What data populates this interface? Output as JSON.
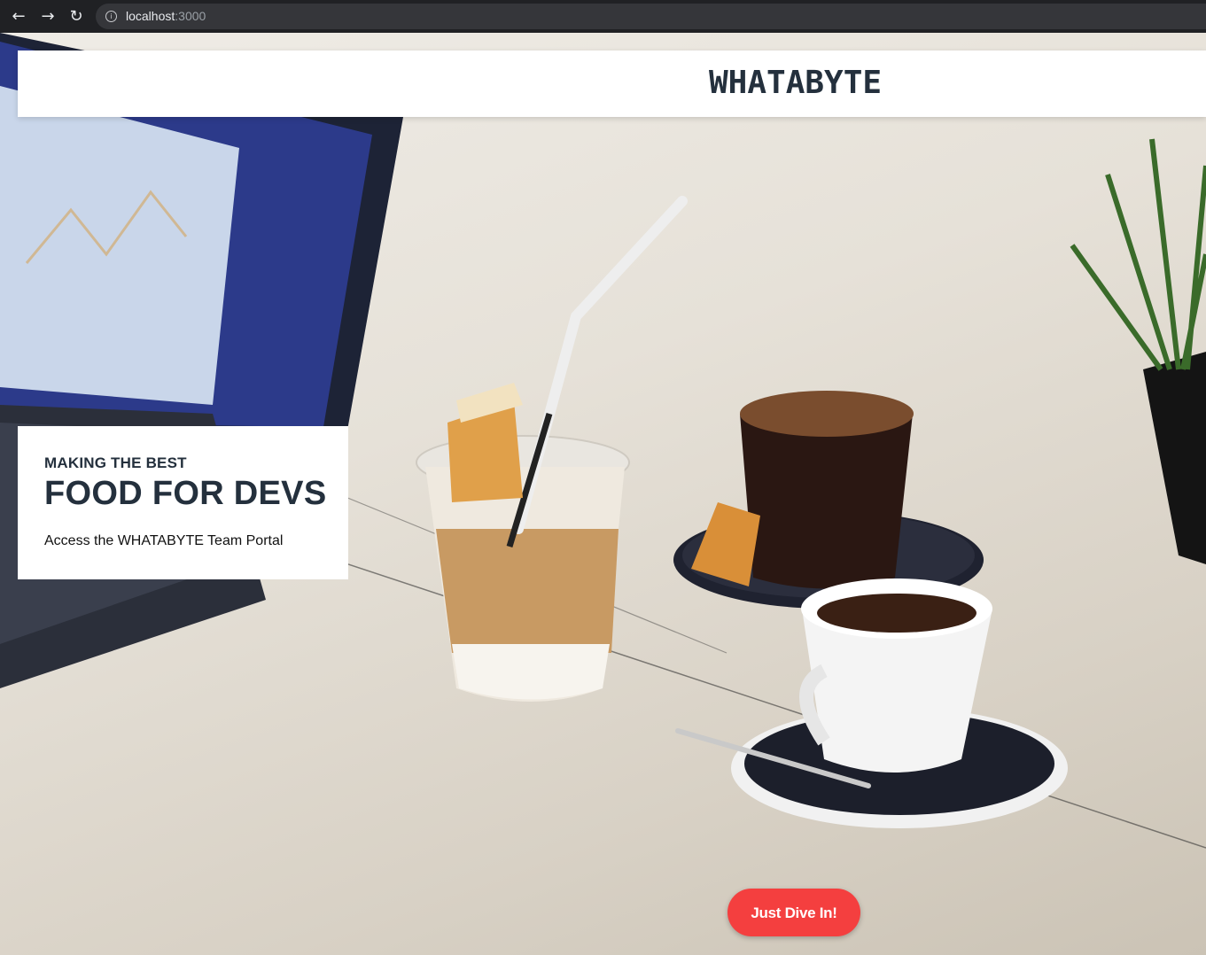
{
  "browser": {
    "back_icon": "arrow-left-icon",
    "forward_icon": "arrow-right-icon",
    "reload_icon": "reload-icon",
    "info_icon": "info-icon",
    "url_host": "localhost",
    "url_port": ":3000"
  },
  "navbar": {
    "brand": "WHATABYTE"
  },
  "hero": {
    "kicker": "MAKING THE BEST",
    "headline": "FOOD FOR DEVS",
    "subtitle": "Access the WHATABYTE Team Portal",
    "cta_label": "Just Dive In!"
  },
  "colors": {
    "brand_text": "#24303d",
    "cta_bg": "#f43f3f",
    "chrome_bg": "#202124"
  }
}
